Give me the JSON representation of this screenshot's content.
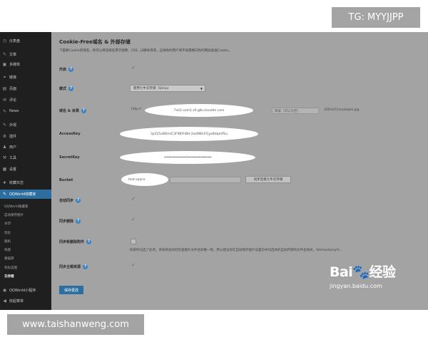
{
  "sidebar": {
    "items": [
      {
        "icon": "dashboard-icon",
        "glyph": "◷",
        "label": "仪表盘"
      },
      {
        "icon": "pin-icon",
        "glyph": "✎",
        "label": "文章"
      },
      {
        "icon": "media-icon",
        "glyph": "▣",
        "label": "多媒体"
      },
      {
        "icon": "link-icon",
        "glyph": "⚭",
        "label": "链接"
      },
      {
        "icon": "page-icon",
        "glyph": "▤",
        "label": "页面"
      },
      {
        "icon": "comment-icon",
        "glyph": "✉",
        "label": "评论"
      },
      {
        "icon": "news-icon",
        "glyph": "✎",
        "label": "News"
      },
      {
        "icon": "appearance-icon",
        "glyph": "✎",
        "label": "外观"
      },
      {
        "icon": "plugin-icon",
        "glyph": "⚙",
        "label": "插件"
      },
      {
        "icon": "user-icon",
        "glyph": "♟",
        "label": "用户"
      },
      {
        "icon": "tools-icon",
        "glyph": "⚒",
        "label": "工具"
      },
      {
        "icon": "settings-icon",
        "glyph": "▦",
        "label": "设置"
      },
      {
        "icon": "collect-icon",
        "glyph": "★",
        "label": "收藏日志"
      }
    ],
    "active": {
      "icon": "qqworld-icon",
      "glyph": "✎",
      "label": "QQWorld收藏家"
    },
    "subitems": [
      "QQWorld收藏家",
      "自动保存图片",
      "水印",
      "优化",
      "随机",
      "布图",
      "素描转",
      "有标志图",
      "云存储"
    ],
    "bottom": [
      {
        "icon": "qqworld-mini-icon",
        "glyph": "◉",
        "label": "QQWorld小程序"
      },
      {
        "icon": "collapse-icon",
        "glyph": "◀",
        "label": "收起菜单"
      }
    ]
  },
  "main": {
    "title": "Cookie-Free域名 & 外部存储",
    "description": "下面要Cookie的域名，你可以将该域名用于图像、CSS、JS脚本等等，这样你的用户将不再需要向你的网站发送Cookie。",
    "fields": {
      "enable": {
        "label": "开启"
      },
      "mode": {
        "label": "模式",
        "value": "使用七牛云存储（Qiniu）",
        "options_arrow": "▼"
      },
      "domain": {
        "label": "域名 & 目录",
        "prefix": "http://",
        "value": "7xit2.com1.z0.glb.clouddn.com",
        "dir_placeholder": "目录（可以为空）",
        "example": "/2014/11/example.jpg"
      },
      "accesskey": {
        "label": "AccessKey",
        "value": "3yZ25x8DmIC3F98YhBH-2zeM8n5Yjye8dqmf5Li"
      },
      "secretkey": {
        "label": "SecretKey",
        "value": "••••••••••••••••••••••••••••••••••••••••"
      },
      "bucket": {
        "label": "Bucket",
        "value": "test-space",
        "button": "同步连接七牛云存储"
      },
      "auto_sync": {
        "label": "自动同步"
      },
      "sync_delete": {
        "label": "同步删除"
      },
      "sync_new_attachment": {
        "label": "同步新删除附件",
        "note": "如果你勾选了此项，系统将会同时检查图片文件名的唯一性，所以建议你在自动保存图片设置页中勾选你的自动存储的文件名格式，%timestamp%..."
      },
      "sync_theme": {
        "label": "同步主题资源"
      }
    },
    "save_button": "保存更改"
  },
  "watermarks": {
    "top": "TG: MYYJJPP",
    "bottom": "www.taishanweng.com",
    "baidu_logo": "Bai🐾经验",
    "baidu_url": "jingyan.baidu.com"
  },
  "colors": {
    "active": "#2c6e9f",
    "sidebar": "#1f1f1f",
    "help": "#3c84c3"
  }
}
